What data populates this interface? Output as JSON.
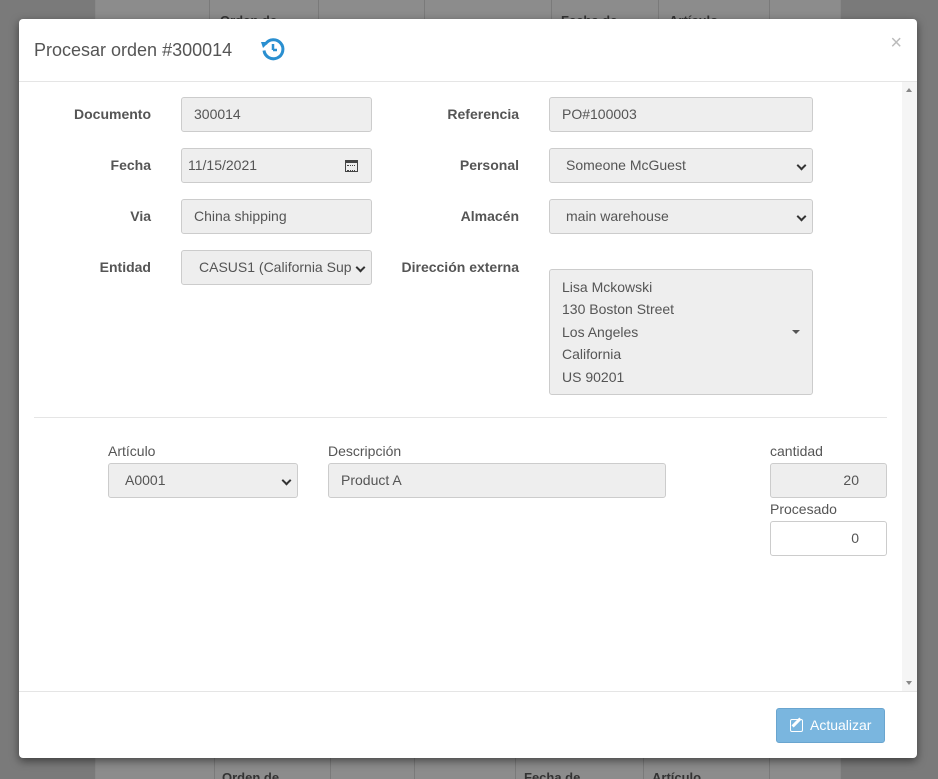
{
  "background": {
    "top_headers": [
      "Orden de",
      "Fecha de",
      "Artículo"
    ],
    "bottom_headers": [
      "Orden de",
      "Fecha de",
      "Artículo"
    ]
  },
  "modal": {
    "title": "Procesar orden #300014",
    "close": "×",
    "history_icon": "history-icon"
  },
  "form": {
    "documento": {
      "label": "Documento",
      "value": "300014"
    },
    "fecha": {
      "label": "Fecha",
      "value": "11/15/2021",
      "icon": "calendar-icon"
    },
    "via": {
      "label": "Via",
      "value": "China shipping"
    },
    "entidad": {
      "label": "Entidad",
      "value": "CASUS1 (California Sup"
    },
    "referencia": {
      "label": "Referencia",
      "value": "PO#100003"
    },
    "personal": {
      "label": "Personal",
      "value": "Someone McGuest"
    },
    "almacen": {
      "label": "Almacén",
      "value": "main warehouse"
    },
    "direccion": {
      "label": "Dirección externa",
      "lines": [
        "Lisa Mckowski",
        "130 Boston Street",
        "Los Angeles",
        "California",
        "US 90201"
      ]
    }
  },
  "item": {
    "articulo": {
      "label": "Artículo",
      "value": "A0001"
    },
    "descripcion": {
      "label": "Descripción",
      "value": "Product A"
    },
    "cantidad": {
      "label": "cantidad",
      "value": "20"
    },
    "procesado": {
      "label": "Procesado",
      "value": "0"
    }
  },
  "footer": {
    "update_label": "Actualizar",
    "update_icon": "edit-icon"
  },
  "colors": {
    "accent": "#2a8fd0",
    "button": "#7ab6df"
  }
}
